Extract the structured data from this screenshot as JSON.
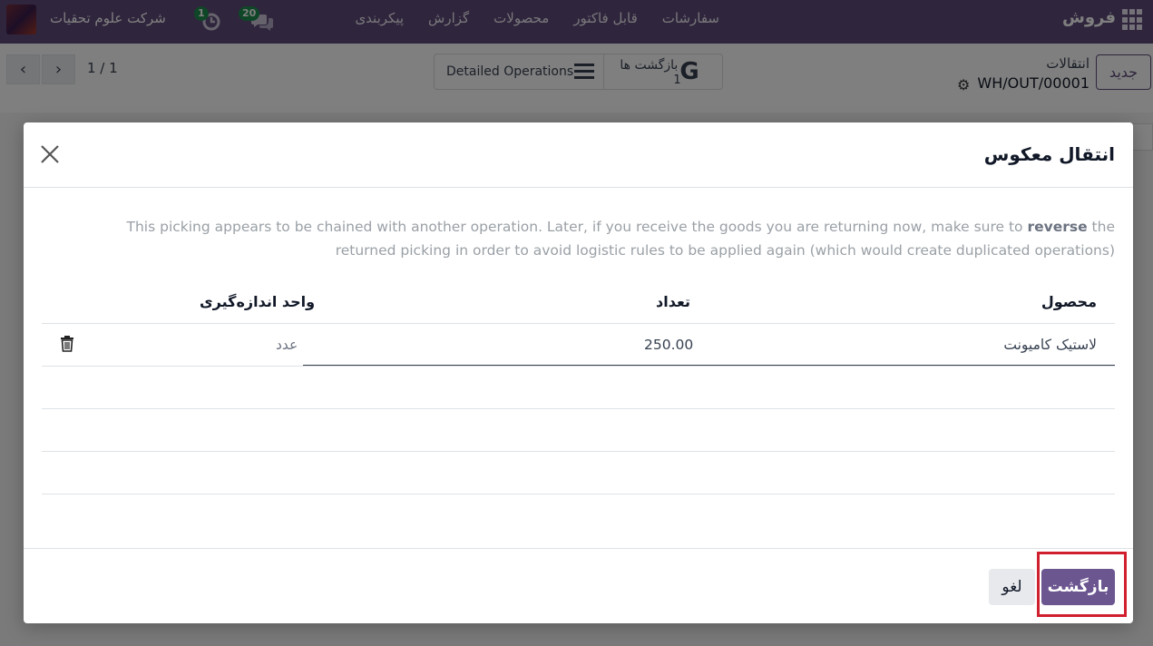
{
  "navbar": {
    "brand": "فروش",
    "menu": [
      "سفارشات",
      "قابل فاکتور",
      "محصولات",
      "گزارش",
      "پیکربندی"
    ],
    "company": "شرکت علوم تحقیات",
    "activity_count": "1",
    "messages_count": "20"
  },
  "control": {
    "new_label": "جدید",
    "breadcrumb_parent": "انتقالات",
    "breadcrumb_record": "WH/OUT/00001",
    "detailed_ops_label": "Detailed Operations",
    "returns_label": "بازگشت ها",
    "returns_count": "1",
    "pager": "1 / 1"
  },
  "dialog": {
    "title": "انتقال معکوس",
    "warning_before": "This picking appears to be chained with another operation. Later, if you receive the goods you are returning now, make sure to ",
    "warning_bold": "reverse",
    "warning_after": " the returned picking in order to avoid logistic rules to be applied again (which would create duplicated operations)",
    "columns": {
      "product": "محصول",
      "quantity": "تعداد",
      "uom": "واحد اندازه‌گیری"
    },
    "lines": [
      {
        "product": "لاستیک کامیونت",
        "quantity": "250.00",
        "uom": "عدد"
      }
    ],
    "return_button": "بازگشت",
    "cancel_button": "لغو"
  },
  "colors": {
    "navbar": "#5f4b7a",
    "primary": "#6b5690",
    "highlight": "#d0202e",
    "badge": "#1e8c4e"
  }
}
